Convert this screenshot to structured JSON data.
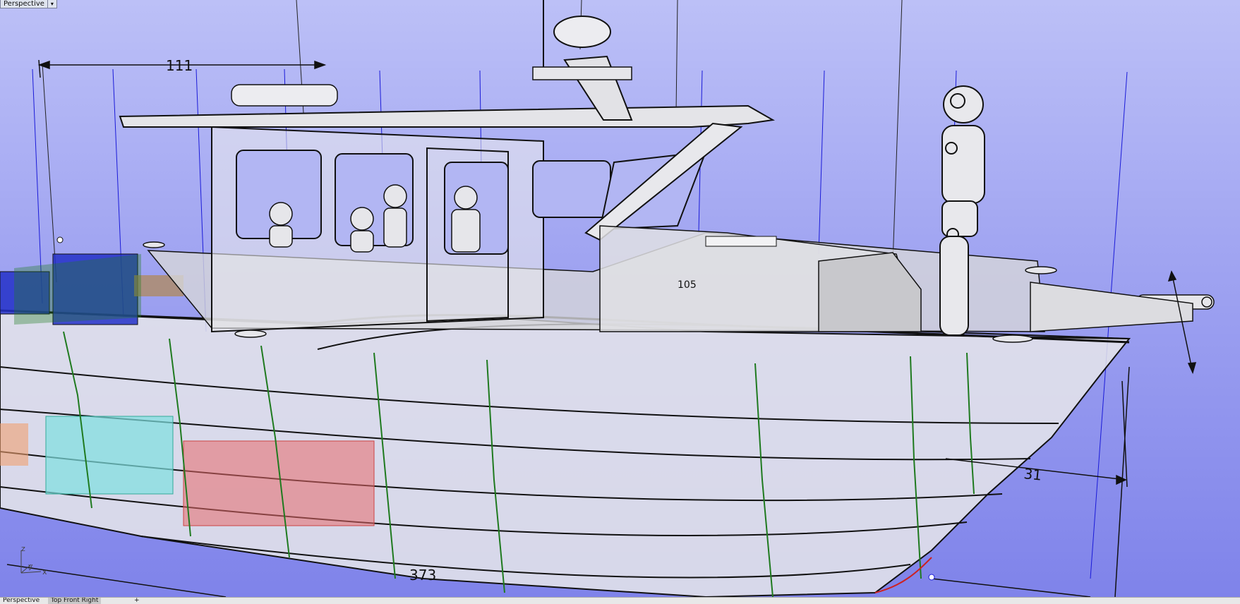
{
  "viewport": {
    "title": "Perspective",
    "menu_arrow": "▾"
  },
  "dimensions": {
    "top_length": "111",
    "keel_length": "373",
    "bow_height": "31",
    "cabin_partial": "105"
  },
  "axis": {
    "z": "z",
    "y": "y",
    "x": "x"
  },
  "tabs": [
    {
      "label": "Perspective"
    },
    {
      "label": "Top  Front  Right"
    },
    {
      "label": "+"
    }
  ],
  "colors": {
    "background_top": "#bcc0f7",
    "background_bottom": "#7f83ea",
    "frame_green": "#1f7a1f",
    "guide_blue": "#1a1ad8",
    "tank_blue": "#2330c8",
    "tank_cyan": "#7de0e0",
    "tank_red": "#e86a6a"
  }
}
